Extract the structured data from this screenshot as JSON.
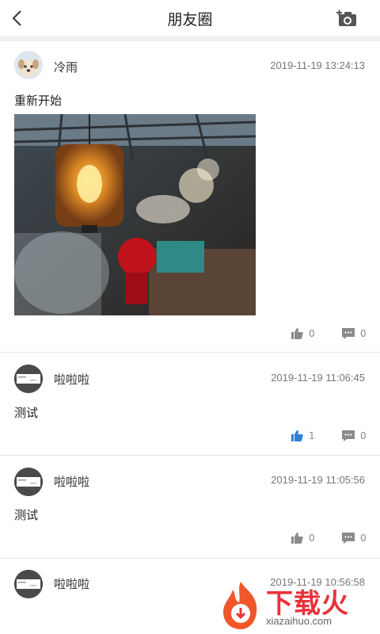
{
  "header": {
    "title": "朋友圈"
  },
  "posts": [
    {
      "user": "冷雨",
      "time": "2019-11-19 13:24:13",
      "text": "重新开始",
      "likes": "0",
      "comments": "0",
      "liked": false
    },
    {
      "user": "啦啦啦",
      "time": "2019-11-19 11:06:45",
      "text": "测试",
      "likes": "1",
      "comments": "0",
      "liked": true
    },
    {
      "user": "啦啦啦",
      "time": "2019-11-19 11:05:56",
      "text": "测试",
      "likes": "0",
      "comments": "0",
      "liked": false
    },
    {
      "user": "啦啦啦",
      "time": "2019-11-19 10:56:58",
      "text": ""
    }
  ],
  "watermark": {
    "brand": "下载火",
    "domain": "xiazaihuo.com"
  },
  "colors": {
    "like_active": "#2f7fd8",
    "icon_gray": "#8a8a8a",
    "brand_red": "#e8323a"
  }
}
